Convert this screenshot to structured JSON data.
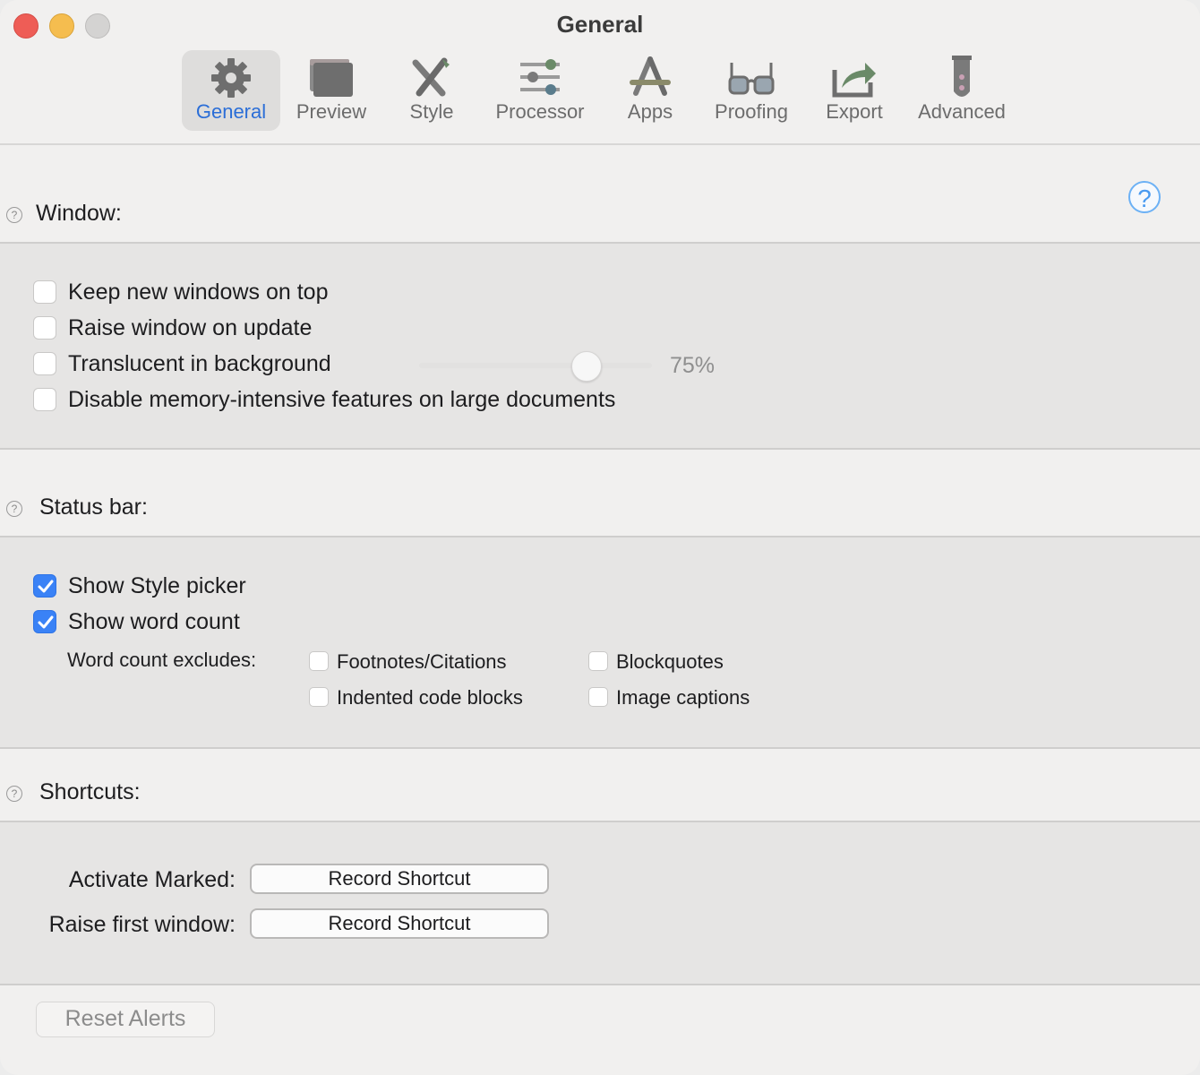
{
  "window": {
    "title": "General"
  },
  "toolbar": {
    "tabs": [
      {
        "label": "General",
        "icon": "gear-icon",
        "active": true
      },
      {
        "label": "Preview",
        "icon": "preview-window-icon"
      },
      {
        "label": "Style",
        "icon": "style-tools-icon"
      },
      {
        "label": "Processor",
        "icon": "sliders-icon"
      },
      {
        "label": "Apps",
        "icon": "app-store-icon"
      },
      {
        "label": "Proofing",
        "icon": "glasses-icon"
      },
      {
        "label": "Export",
        "icon": "share-arrow-icon"
      },
      {
        "label": "Advanced",
        "icon": "test-tube-icon"
      }
    ]
  },
  "window_section": {
    "title": "Window:",
    "options": [
      {
        "label": "Keep new windows on top",
        "checked": false
      },
      {
        "label": "Raise window on update",
        "checked": false
      },
      {
        "label": "Translucent in background",
        "checked": false
      },
      {
        "label": "Disable memory-intensive features on large documents",
        "checked": false
      }
    ],
    "translucency": {
      "value": 75,
      "display": "75%"
    }
  },
  "status_section": {
    "title": "Status bar:",
    "options": [
      {
        "label": "Show Style picker",
        "checked": true
      },
      {
        "label": "Show word count",
        "checked": true
      }
    ],
    "excludes_label": "Word count excludes:",
    "excludes": [
      {
        "label": "Footnotes/Citations",
        "checked": false
      },
      {
        "label": "Blockquotes",
        "checked": false
      },
      {
        "label": "Indented code blocks",
        "checked": false
      },
      {
        "label": "Image captions",
        "checked": false
      }
    ]
  },
  "shortcuts_section": {
    "title": "Shortcuts:",
    "rows": [
      {
        "label": "Activate Marked:",
        "button": "Record Shortcut"
      },
      {
        "label": "Raise first window:",
        "button": "Record Shortcut"
      }
    ]
  },
  "footer": {
    "reset_label": "Reset Alerts"
  },
  "help": {
    "glyph": "?",
    "small_glyph": "?"
  },
  "colors": {
    "accent": "#2b6ed7",
    "checkbox_on": "#3a82f6"
  }
}
